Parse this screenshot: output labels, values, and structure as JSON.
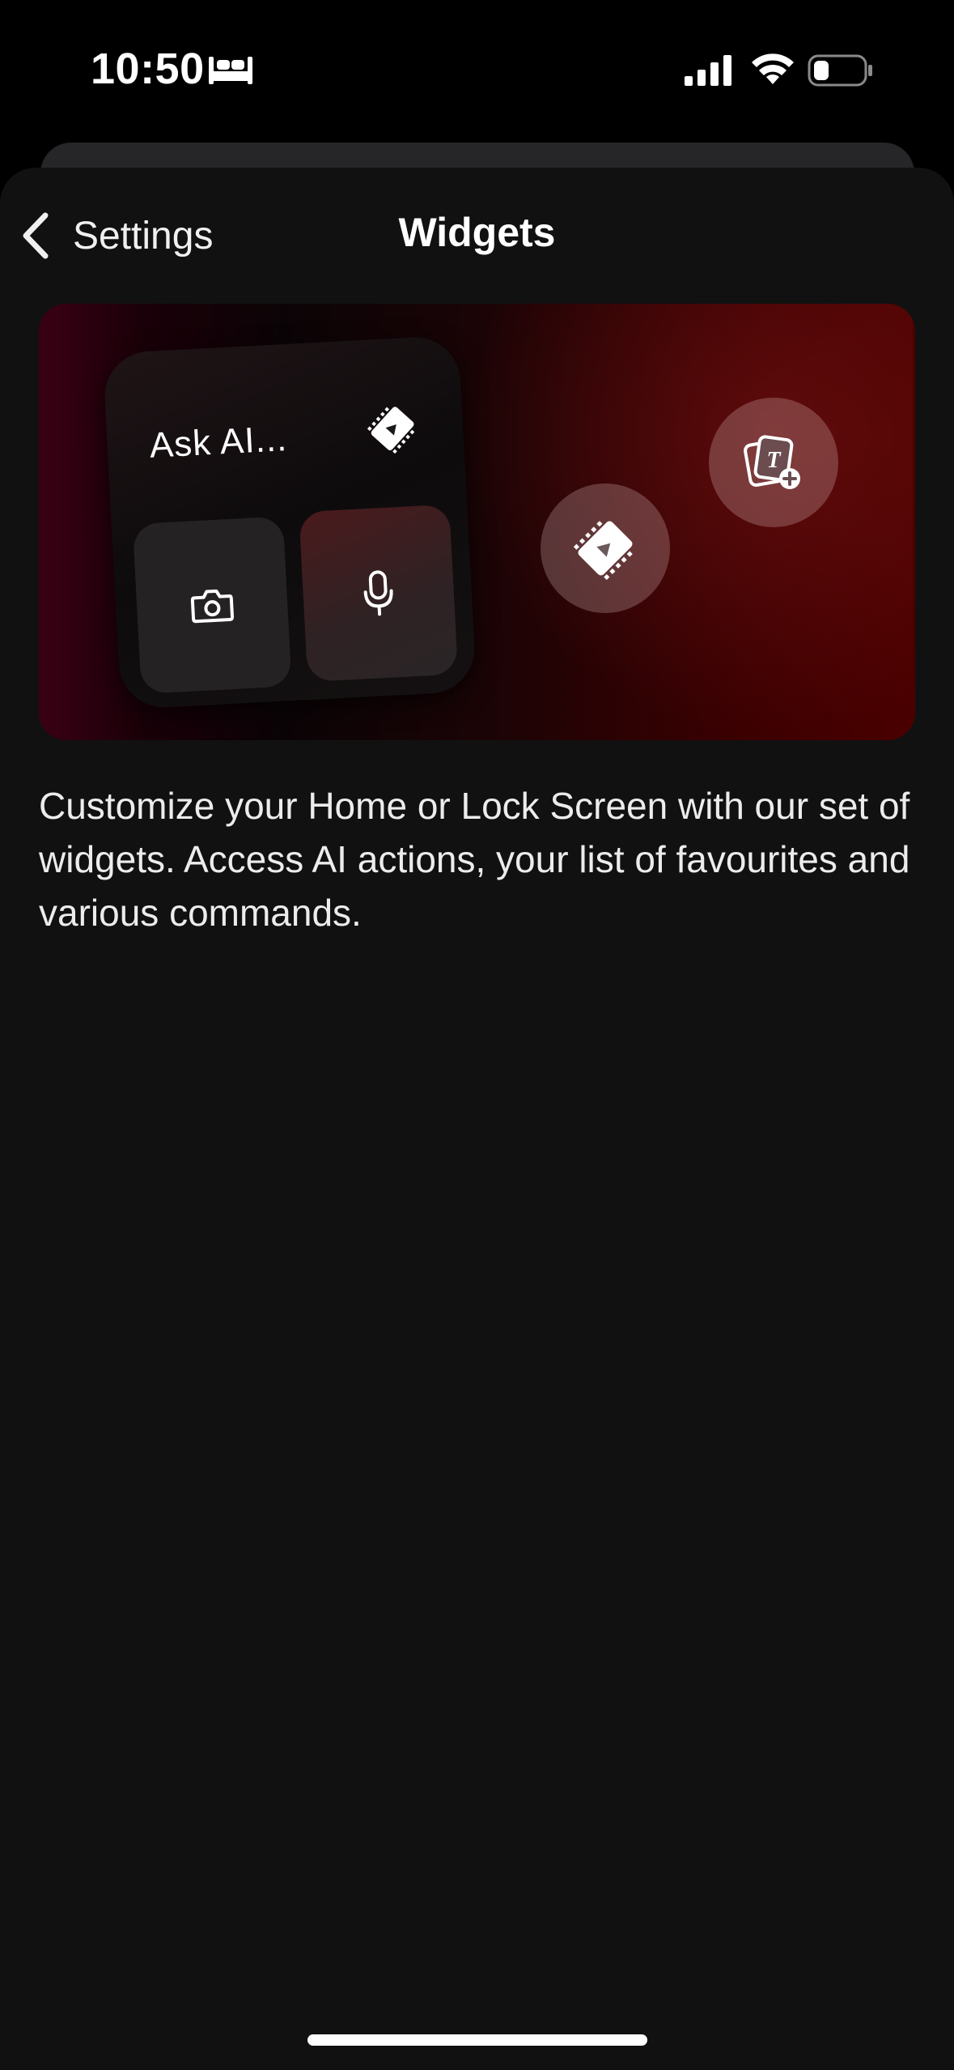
{
  "status_bar": {
    "time": "10:50",
    "icons": [
      "bed-icon",
      "cellular-signal-icon",
      "wifi-icon",
      "battery-icon"
    ]
  },
  "nav": {
    "back_label": "Settings",
    "title": "Widgets"
  },
  "hero": {
    "widget_label": "Ask AI...",
    "icons": [
      "video-icon",
      "camera-icon",
      "microphone-icon",
      "add-text-card-icon"
    ]
  },
  "description": "Customize your Home or Lock Screen with our set of widgets. Access AI actions, your list of favourites and various commands.",
  "colors": {
    "background": "#000000",
    "sheet": "#111111",
    "accent_dark_red": "#4a0000"
  }
}
